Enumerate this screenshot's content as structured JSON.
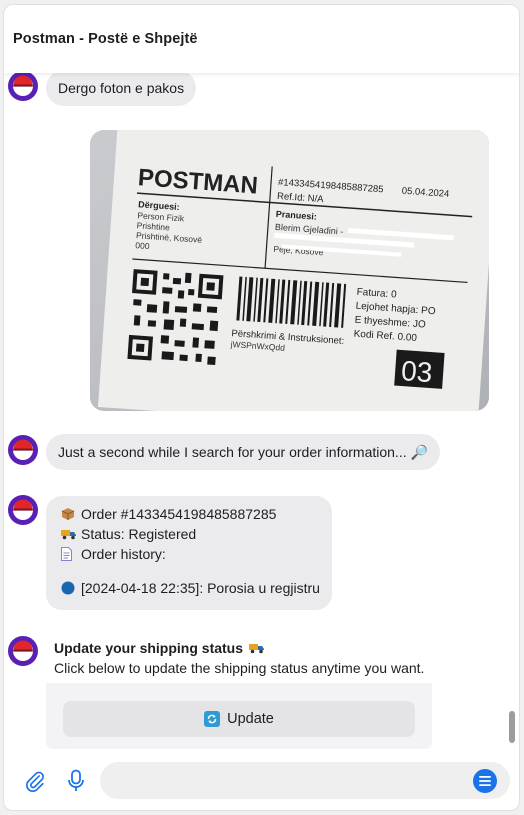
{
  "header": {
    "title": "Postman - Postë e Shpejtë"
  },
  "messages": {
    "m1": "Dergo foton e pakos",
    "m2": "Just a second while I search for your order information... 🔎",
    "m3": {
      "order": "Order #1433454198485887285",
      "status": "Status: Registered",
      "history_label": "Order history:",
      "history_entry": "[2024-04-18 22:35]: Porosia u regjistru"
    }
  },
  "photo": {
    "brand": "POSTMAN",
    "tracking": "#1433454198485887285",
    "date": "05.04.2024",
    "ref": "Ref.Id: N/A",
    "sender_label": "Dërguesi:",
    "sender_lines": [
      "Person Fizik",
      "Prishtine",
      "Prishtinë, Kosovë",
      "000"
    ],
    "receiver_label": "Pranuesi:",
    "receiver_lines": [
      "Blerim Gjeladini -",
      "",
      "Pejë, Kosovë"
    ],
    "fatura": "Fatura: 0",
    "lejohet": "Lejohet hapja: PO",
    "thyeshme": "E thyeshme: JO",
    "kodi": "Kodi Ref. 0.00",
    "pershkrimi": "Përshkrimi & Instruksionet:",
    "code": "jWSPnWxQdd",
    "box": "03"
  },
  "card": {
    "title": "Update your shipping status",
    "description": "Click below to update the shipping status anytime you want.",
    "button_label": "Update"
  },
  "composer": {
    "placeholder": ""
  },
  "colors": {
    "avatar": "#5a1fb5",
    "accent": "#1a73e8",
    "bubble": "#ebebed"
  }
}
